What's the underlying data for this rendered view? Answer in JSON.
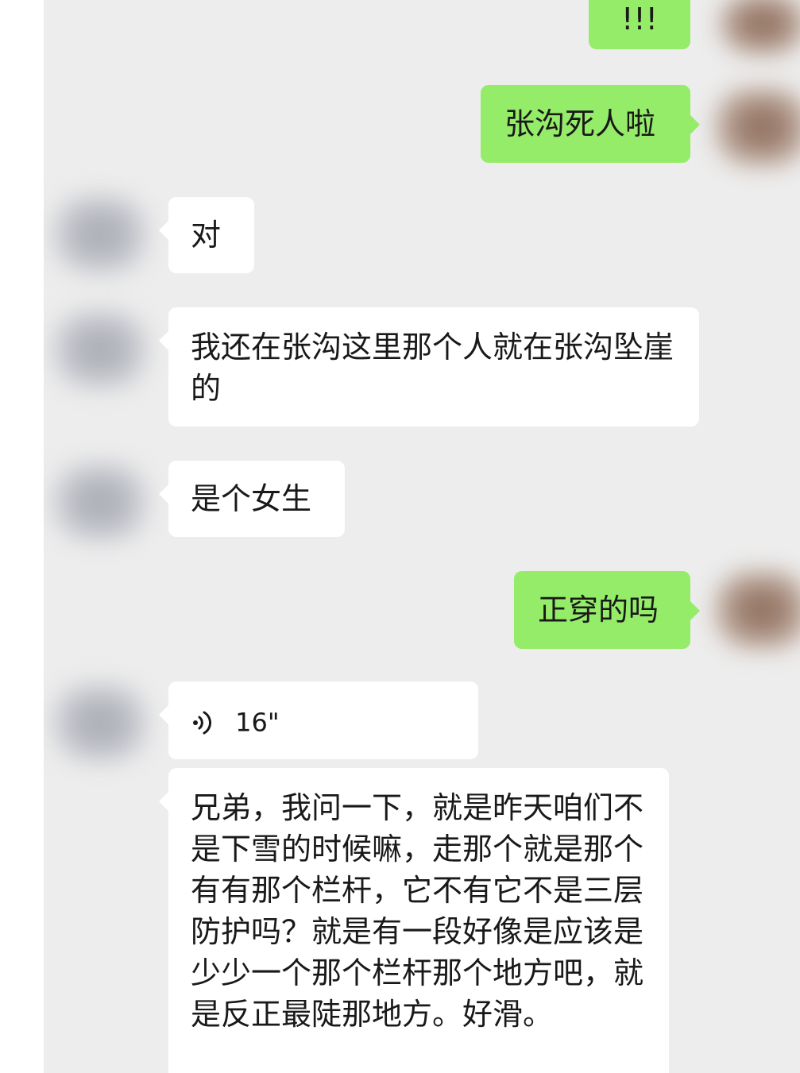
{
  "messages": [
    {
      "side": "out",
      "type": "text",
      "text": "!!!"
    },
    {
      "side": "out",
      "type": "text",
      "text": "张沟死人啦"
    },
    {
      "side": "in",
      "type": "text",
      "text": "对"
    },
    {
      "side": "in",
      "type": "text",
      "text": "我还在张沟这里那个人就在张沟坠崖的"
    },
    {
      "side": "in",
      "type": "text",
      "text": "是个女生"
    },
    {
      "side": "out",
      "type": "text",
      "text": "正穿的吗"
    },
    {
      "side": "in",
      "type": "voice",
      "duration": "16\"",
      "icon": "voice-wave-icon"
    },
    {
      "side": "in",
      "type": "text",
      "text": "兄弟，我问一下，就是昨天咱们不是下雪的时候嘛，走那个就是那个有有那个栏杆，它不有它不是三层防护吗？就是有一段好像是应该是少少一个那个栏杆那个地方吧，就是反正最陡那地方。好滑。"
    }
  ],
  "colors": {
    "background": "#ededed",
    "incoming_bubble": "#ffffff",
    "outgoing_bubble": "#95ec69",
    "text": "#191919"
  }
}
